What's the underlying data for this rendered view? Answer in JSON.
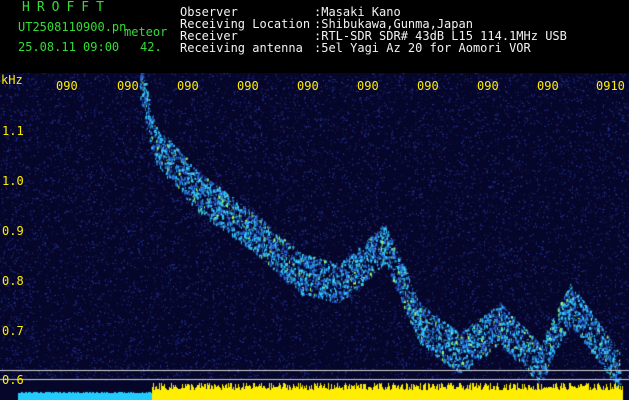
{
  "header": {
    "brand": "HROFFT",
    "file_name": "UT2508110900.pn",
    "kind": "meteor",
    "datetime": "25.08.11 09:00",
    "number": "42.",
    "fields": [
      {
        "label": "Observer",
        "value": ":Masaki Kano"
      },
      {
        "label": "Receiving Location",
        "value": ":Shibukawa,Gunma,Japan"
      },
      {
        "label": "Receiver",
        "value": ":RTL-SDR SDR# 43dB L15 114.1MHz USB"
      },
      {
        "label": "Receiving antenna",
        "value": ":5el Yagi Az 20 for Aomori VOR"
      }
    ]
  },
  "spectrogram": {
    "unit": "kHz",
    "time_labels": [
      "090",
      "090",
      "090",
      "090",
      "090",
      "090",
      "090",
      "090",
      "090",
      "0910"
    ],
    "freq_labels": [
      "1.1",
      "1.0",
      "0.9",
      "0.8",
      "0.7",
      "0.6"
    ],
    "colors": {
      "background": "#0a0a3a",
      "signal": "#33ccff",
      "header_text": "#ffffff",
      "brand_text": "#33dd33",
      "tick_text": "#ffee00",
      "level_bar_left": "#22ccff",
      "level_bar_right": "#ffee00"
    }
  }
}
